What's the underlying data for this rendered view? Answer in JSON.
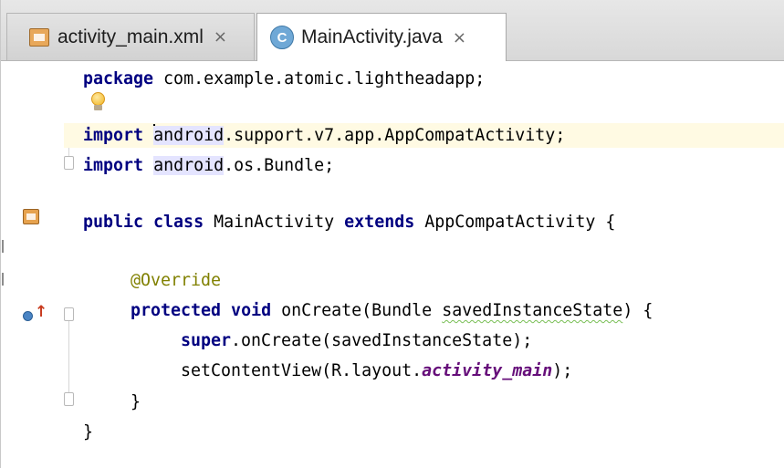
{
  "tabs": [
    {
      "label": "activity_main.xml",
      "icon": "xml-file-icon",
      "close": "×",
      "active": false
    },
    {
      "label": "MainActivity.java",
      "icon": "java-class-icon",
      "icon_letter": "C",
      "close": "×",
      "active": true
    }
  ],
  "editor": {
    "line1": {
      "kw": "package",
      "rest": " com.example.atomic.lightheadapp;"
    },
    "line2": {
      "kw": "import",
      "ident": "android",
      "rest": ".support.v7.app.AppCompatActivity;"
    },
    "line3": {
      "kw": "import",
      "ident": "android",
      "rest": ".os.Bundle;"
    },
    "line4": {
      "kw": "public class",
      "name": " MainActivity ",
      "kw2": "extends",
      "rest": " AppCompatActivity {"
    },
    "line5": {
      "annotation": "@Override"
    },
    "line6": {
      "kw": "protected void",
      "pre": " onCreate(Bundle ",
      "squiggle": "savedInstanceState",
      "rest": ") {"
    },
    "line7": {
      "kw": "super",
      "rest": ".onCreate(savedInstanceState);"
    },
    "line8": {
      "pre": "setContentView(R.layout.",
      "field": "activity_main",
      "rest": ");"
    },
    "line9": {
      "text": "}"
    },
    "line10": {
      "text": "}"
    }
  },
  "colors": {
    "keyword": "#000080",
    "annotation": "#808000",
    "field": "#660e7a",
    "caret_row": "#fffae3",
    "identifier_highlight": "#e4e4ff"
  }
}
